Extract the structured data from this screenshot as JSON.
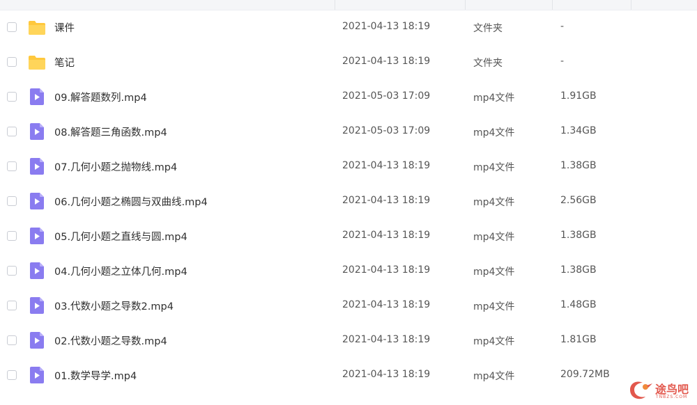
{
  "colors": {
    "folder": "#ffc83d",
    "video": "#8a7cf0",
    "watermark": "#e2574c"
  },
  "files": [
    {
      "name": "课件",
      "date": "2021-04-13 18:19",
      "type": "文件夹",
      "size": "-",
      "icon": "folder-icon"
    },
    {
      "name": "笔记",
      "date": "2021-04-13 18:19",
      "type": "文件夹",
      "size": "-",
      "icon": "folder-icon"
    },
    {
      "name": "09.解答题数列.mp4",
      "date": "2021-05-03 17:09",
      "type": "mp4文件",
      "size": "1.91GB",
      "icon": "video-file-icon"
    },
    {
      "name": "08.解答题三角函数.mp4",
      "date": "2021-05-03 17:09",
      "type": "mp4文件",
      "size": "1.34GB",
      "icon": "video-file-icon"
    },
    {
      "name": "07.几何小题之抛物线.mp4",
      "date": "2021-04-13 18:19",
      "type": "mp4文件",
      "size": "1.38GB",
      "icon": "video-file-icon"
    },
    {
      "name": "06.几何小题之椭圆与双曲线.mp4",
      "date": "2021-04-13 18:19",
      "type": "mp4文件",
      "size": "2.56GB",
      "icon": "video-file-icon"
    },
    {
      "name": "05.几何小题之直线与圆.mp4",
      "date": "2021-04-13 18:19",
      "type": "mp4文件",
      "size": "1.38GB",
      "icon": "video-file-icon"
    },
    {
      "name": "04.几何小题之立体几何.mp4",
      "date": "2021-04-13 18:19",
      "type": "mp4文件",
      "size": "1.38GB",
      "icon": "video-file-icon"
    },
    {
      "name": "03.代数小题之导数2.mp4",
      "date": "2021-04-13 18:19",
      "type": "mp4文件",
      "size": "1.48GB",
      "icon": "video-file-icon"
    },
    {
      "name": "02.代数小题之导数.mp4",
      "date": "2021-04-13 18:19",
      "type": "mp4文件",
      "size": "1.81GB",
      "icon": "video-file-icon"
    },
    {
      "name": "01.数学导学.mp4",
      "date": "2021-04-13 18:19",
      "type": "mp4文件",
      "size": "209.72MB",
      "icon": "video-file-icon"
    }
  ],
  "watermark": {
    "text": "途鸟吧",
    "sub": "TNBZS.COM"
  }
}
